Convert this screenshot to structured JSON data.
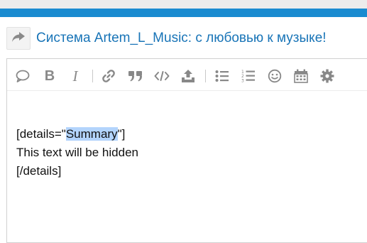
{
  "header": {
    "topic_title": "Система Artem_L_Music: с любовью к музыке!",
    "reply_icon": "share-arrow-icon"
  },
  "toolbar": {
    "items": [
      {
        "name": "quote-bubble-icon"
      },
      {
        "name": "bold-icon",
        "glyph": "B"
      },
      {
        "name": "italic-icon",
        "glyph": "I"
      },
      {
        "name": "link-icon"
      },
      {
        "name": "blockquote-icon"
      },
      {
        "name": "code-icon"
      },
      {
        "name": "upload-icon"
      },
      {
        "name": "bullet-list-icon"
      },
      {
        "name": "numbered-list-icon"
      },
      {
        "name": "emoji-icon"
      },
      {
        "name": "calendar-icon"
      },
      {
        "name": "gear-icon"
      }
    ]
  },
  "editor": {
    "line1_prefix": "[details=\"",
    "line1_selected": "Summary",
    "line1_suffix": "\"]",
    "line2": "This text will be hidden",
    "line3": "[/details]"
  }
}
